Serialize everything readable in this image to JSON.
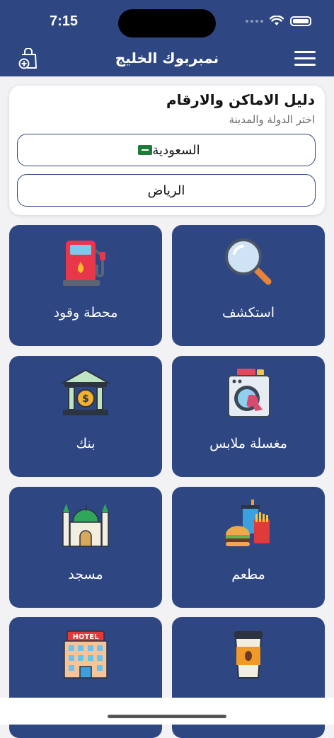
{
  "status": {
    "time": "7:15"
  },
  "header": {
    "title": "نمبربوك الخليج"
  },
  "directory": {
    "title": "دليل الاماكن والارقام",
    "subtitle": "اختر الدولة والمدينة",
    "country": "السعودية",
    "city": "الرياض"
  },
  "categories": [
    {
      "label": "استكشف",
      "icon": "magnifier-icon"
    },
    {
      "label": "محطة وقود",
      "icon": "fuel-pump-icon"
    },
    {
      "label": "مغسلة ملابس",
      "icon": "washing-machine-icon"
    },
    {
      "label": "بنك",
      "icon": "bank-icon"
    },
    {
      "label": "مطعم",
      "icon": "fast-food-icon"
    },
    {
      "label": "مسجد",
      "icon": "mosque-icon"
    },
    {
      "label": "",
      "icon": "coffee-cup-icon"
    },
    {
      "label": "",
      "icon": "hotel-icon"
    }
  ],
  "hotel_sign": "HOTEL",
  "colors": {
    "header_bg": "#2e4682",
    "tile_bg": "#2e4682",
    "page_bg": "#f2f2f4"
  }
}
